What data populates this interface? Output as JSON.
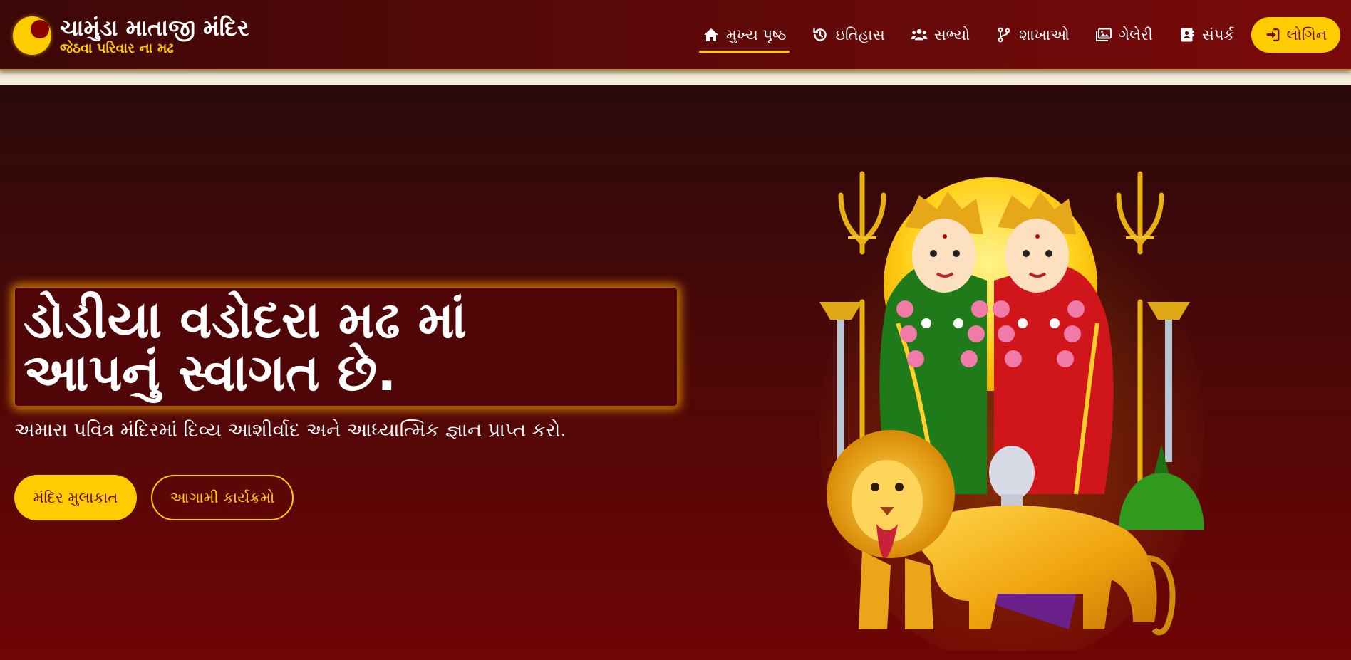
{
  "brand": {
    "title": "ચામુંડા માતાજી મંદિર",
    "subtitle": "જેઠવા પરિવાર ના મઢ",
    "logo_icon": "sun-moon-logo-icon"
  },
  "nav": {
    "items": [
      {
        "label": "મુખ્ય પૃષ્ઠ",
        "icon": "home-icon",
        "active": true
      },
      {
        "label": "ઇતિહાસ",
        "icon": "history-icon",
        "active": false
      },
      {
        "label": "સભ્યો",
        "icon": "users-icon",
        "active": false
      },
      {
        "label": "શાખાઓ",
        "icon": "branch-icon",
        "active": false
      },
      {
        "label": "ગેલેરી",
        "icon": "gallery-icon",
        "active": false
      },
      {
        "label": "સંપર્ક",
        "icon": "contact-icon",
        "active": false
      }
    ],
    "login_label": "લોગિન",
    "login_icon": "sign-in-icon"
  },
  "hero": {
    "headline_line1": "ડોડીયા વડોદરા મઢ માં",
    "headline_line2": "આપનું સ્વાગત છે.",
    "subtext": "અમારા પવિત્ર મંદિરમાં દિવ્ય આશીર્વાદ અને આધ્યાત્મિક જ્ઞાન પ્રાપ્ત કરો.",
    "primary_button": "મંદિર મુલાકાત",
    "secondary_button": "આગામી કાર્યક્રમો"
  },
  "colors": {
    "accent": "#ffcc00",
    "maroon_dark": "#3c0808",
    "maroon": "#7a0a0a",
    "cream": "#f6f0e0"
  }
}
